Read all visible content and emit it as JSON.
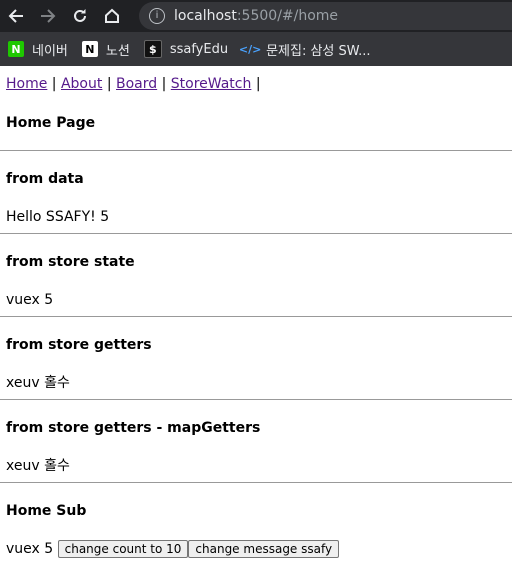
{
  "browser": {
    "url_host": "localhost",
    "url_rest": ":5500/#/home",
    "bookmarks": [
      {
        "label": "네이버",
        "icon": "naver-icon",
        "glyph": "N"
      },
      {
        "label": "노션",
        "icon": "notion-icon",
        "glyph": "N"
      },
      {
        "label": "ssafyEdu",
        "icon": "ssafy-icon",
        "glyph": "$"
      },
      {
        "label": "문제집: 삼성 SW...",
        "icon": "code-icon",
        "glyph": "</>"
      }
    ]
  },
  "nav": {
    "links": [
      "Home",
      "About",
      "Board",
      "StoreWatch"
    ],
    "separator": "|"
  },
  "page": {
    "title": "Home Page",
    "sections": [
      {
        "title": "from data",
        "value": "Hello SSAFY! 5"
      },
      {
        "title": "from store state",
        "value": "vuex 5"
      },
      {
        "title": "from store getters",
        "value": "xeuv 홀수"
      },
      {
        "title": "from store getters - mapGetters",
        "value": "xeuv 홀수"
      }
    ],
    "sub": {
      "title": "Home Sub",
      "value": "vuex 5",
      "buttons": [
        "change count to 10",
        "change message ssafy"
      ]
    }
  },
  "colors": {
    "chrome_dark": "#202124",
    "chrome_bar": "#35363a",
    "link_visited": "#551a8b"
  }
}
